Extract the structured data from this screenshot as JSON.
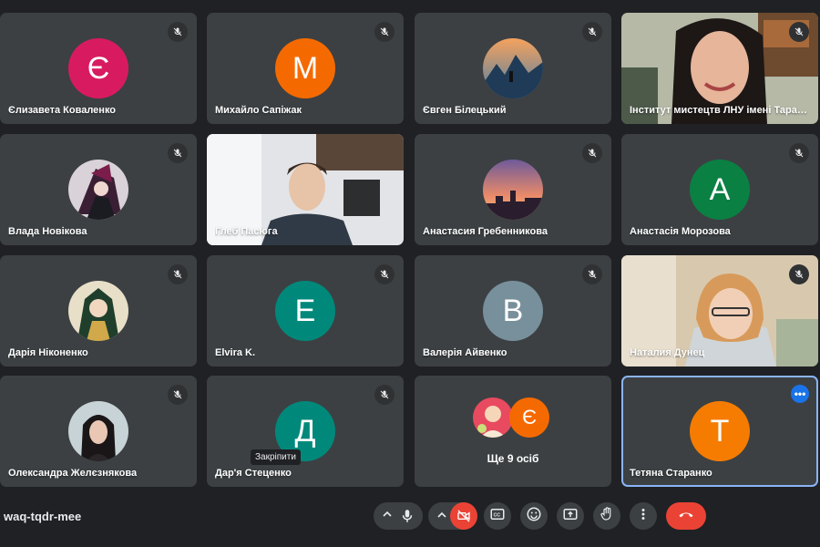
{
  "colors": {
    "background": "#202124",
    "tile": "#3c4043",
    "accent_blue": "#1a73e8",
    "danger_red": "#ea4335"
  },
  "participants": [
    {
      "name": "Єлизавета Коваленко",
      "initial": "Є",
      "avatar_color": "#d81b60",
      "muted": true,
      "kind": "initial"
    },
    {
      "name": "Михайло Сапіжак",
      "initial": "М",
      "avatar_color": "#f56a00",
      "muted": true,
      "kind": "initial"
    },
    {
      "name": "Євген Білецький",
      "muted": true,
      "kind": "photo",
      "photo": "mountain-avatar"
    },
    {
      "name": "Інститут мистецтв ЛНУ імені Тараса...",
      "muted": true,
      "kind": "video",
      "video": "woman-video"
    },
    {
      "name": "Влада Новікова",
      "muted": true,
      "kind": "photo",
      "photo": "anime-avatar"
    },
    {
      "name": "Глеб Пасюга",
      "muted": false,
      "kind": "video",
      "video": "young-man-video"
    },
    {
      "name": "Анастасия Гребенникова",
      "muted": true,
      "kind": "photo",
      "photo": "sunset-avatar"
    },
    {
      "name": "Анастасія Морозова",
      "initial": "А",
      "avatar_color": "#0b8043",
      "muted": true,
      "kind": "initial"
    },
    {
      "name": "Дарія Ніконенко",
      "muted": true,
      "kind": "photo",
      "photo": "illustration-avatar"
    },
    {
      "name": "Elvira K.",
      "initial": "E",
      "avatar_color": "#00897b",
      "muted": true,
      "kind": "initial"
    },
    {
      "name": "Валерія Айвенко",
      "initial": "В",
      "avatar_color": "#78909c",
      "muted": true,
      "kind": "initial"
    },
    {
      "name": "Наталия Дунец",
      "muted": true,
      "kind": "video",
      "video": "older-woman-video"
    },
    {
      "name": "Олександра Желєзнякова",
      "muted": true,
      "kind": "photo",
      "photo": "dark-hair-avatar"
    },
    {
      "name": "Дар'я Стеценко",
      "initial": "Д",
      "avatar_color": "#00897b",
      "muted": true,
      "kind": "initial",
      "tooltip": "Закріпити"
    },
    {
      "name": "Ще 9 осіб",
      "kind": "others",
      "second_initial": "Є",
      "second_color": "#f56a00"
    },
    {
      "name": "Тетяна Старанко",
      "initial": "Т",
      "avatar_color": "#f57c00",
      "muted": false,
      "kind": "initial",
      "speaking": true,
      "more_badge": "•••"
    }
  ],
  "bottom_bar": {
    "meeting_code": "waq-tqdr-mee",
    "controls": [
      {
        "name": "mic-options-chevron",
        "icon": "chevron-up"
      },
      {
        "name": "mic-button",
        "icon": "mic-icon"
      },
      {
        "name": "camera-options-chevron",
        "icon": "chevron-up"
      },
      {
        "name": "camera-button",
        "icon": "camera-off-icon",
        "state": "off"
      },
      {
        "name": "captions-button",
        "icon": "captions-icon"
      },
      {
        "name": "reactions-button",
        "icon": "emoji-icon"
      },
      {
        "name": "present-button",
        "icon": "present-icon"
      },
      {
        "name": "raise-hand-button",
        "icon": "hand-icon"
      },
      {
        "name": "more-options-button",
        "icon": "more-vert-icon"
      },
      {
        "name": "leave-call-button",
        "icon": "hang-up-icon"
      }
    ]
  }
}
